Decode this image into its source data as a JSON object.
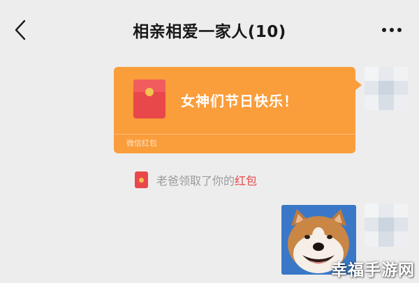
{
  "header": {
    "back_icon": "chevron-left-icon",
    "title": "相亲相爱一家人(10)",
    "more_icon": "more-dots-icon"
  },
  "messages": {
    "red_packet": {
      "greeting": "女神们节日快乐！",
      "footer": "微信红包",
      "color": "#fa9d3b"
    },
    "system": {
      "text": "老爸领取了你的",
      "link": "红包",
      "link_color": "#e9484b"
    },
    "photo": {
      "subject": "shiba-inu-dog-photo"
    }
  },
  "watermark": "幸福手游网"
}
